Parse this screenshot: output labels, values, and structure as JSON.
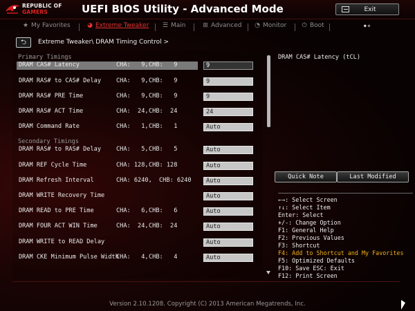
{
  "header": {
    "brand_line1": "REPUBLIC OF",
    "brand_line2": "GAMERS",
    "app_title": "UEFI BIOS Utility - Advanced Mode",
    "exit_label": "Exit"
  },
  "tabs": [
    {
      "label": "My Favorites",
      "icon": "star-icon",
      "glyph": "★",
      "active": false
    },
    {
      "label": "Extreme Tweaker",
      "icon": "rog-eye-icon",
      "glyph": "◕",
      "active": true
    },
    {
      "label": "Main",
      "icon": "list-icon",
      "glyph": "☰",
      "active": false
    },
    {
      "label": "Advanced",
      "icon": "advanced-icon",
      "glyph": "⊞",
      "active": false
    },
    {
      "label": "Monitor",
      "icon": "monitor-icon",
      "glyph": "◔",
      "active": false
    },
    {
      "label": "Boot",
      "icon": "power-icon",
      "glyph": "⏻",
      "active": false
    }
  ],
  "breadcrumb": {
    "back_glyph": "⮌",
    "path": "Extreme Tweaker\\ DRAM Timing Control >"
  },
  "sections": {
    "primary": "Primary Timings",
    "secondary": "Secondary Timings"
  },
  "rows": [
    {
      "label": "DRAM CAS# Latency",
      "cha": "CHA:   9,",
      "chb": "CHB:   9",
      "value": "9",
      "selected": true
    },
    {
      "label": "DRAM RAS# to CAS# Delay",
      "cha": "CHA:   9,",
      "chb": "CHB:   9",
      "value": "9"
    },
    {
      "label": "DRAM RAS# PRE Time",
      "cha": "CHA:   9,",
      "chb": "CHB:   9",
      "value": "9"
    },
    {
      "label": "DRAM RAS# ACT Time",
      "cha": "CHA:  24,",
      "chb": "CHB:  24",
      "value": "24"
    },
    {
      "label": "DRAM Command Rate",
      "cha": "CHA:   1,",
      "chb": "CHB:   1",
      "value": "Auto"
    },
    {
      "label": "DRAM RAS# to RAS# Delay",
      "cha": "CHA:   5,",
      "chb": "CHB:   5",
      "value": "Auto"
    },
    {
      "label": "DRAM REF Cycle Time",
      "cha": "CHA: 128,",
      "chb": "CHB: 128",
      "value": "Auto"
    },
    {
      "label": "DRAM Refresh Interval",
      "cha": "CHA: 6240,",
      "chb": "CHB: 6240",
      "value": "Auto"
    },
    {
      "label": "DRAM WRITE Recovery Time",
      "cha": "",
      "chb": "",
      "value": "Auto"
    },
    {
      "label": "DRAM READ to PRE Time",
      "cha": "CHA:   6,",
      "chb": "CHB:   6",
      "value": "Auto"
    },
    {
      "label": "DRAM FOUR ACT WIN Time",
      "cha": "CHA:  24,",
      "chb": "CHB:  24",
      "value": "Auto"
    },
    {
      "label": "DRAM WRITE to READ Delay",
      "cha": "",
      "chb": "",
      "value": "Auto"
    },
    {
      "label": "DRAM CKE Minimum Pulse Width",
      "cha": "CHA:   4,",
      "chb": "CHB:   4",
      "value": "Auto"
    }
  ],
  "help": {
    "title": "DRAM CAS# Latency (tCL)",
    "quick_note": "Quick Note",
    "last_modified": "Last Modified",
    "keys": [
      {
        "text": "←→: Select Screen"
      },
      {
        "text": "↑↓: Select Item"
      },
      {
        "text": "Enter: Select"
      },
      {
        "text": "+/-: Change Option"
      },
      {
        "text": "F1: General Help"
      },
      {
        "text": "F2: Previous Values"
      },
      {
        "text": "F3: Shortcut"
      },
      {
        "text": "F4: Add to Shortcut and My Favorites",
        "highlight": true
      },
      {
        "text": "F5: Optimized Defaults"
      },
      {
        "text": "F10: Save  ESC: Exit"
      },
      {
        "text": "F12: Print Screen"
      }
    ]
  },
  "footer": "Version 2.10.1208. Copyright (C) 2013 American Megatrends, Inc.",
  "colors": {
    "accent": "#e43131",
    "highlight": "#f2b21a",
    "selected_row": "#7a7a7a"
  }
}
